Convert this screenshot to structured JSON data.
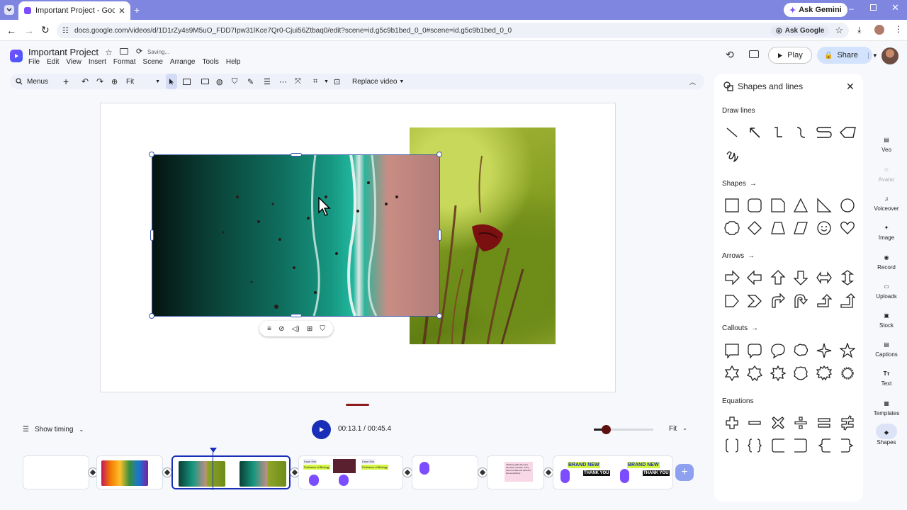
{
  "browser": {
    "tab_title": "Important Project - Google Vid",
    "ask_gemini": "Ask Gemini",
    "url": "docs.google.com/videos/d/1D1rZy4s9M5uO_FDD7Ipw31lKce7Qr0-Cjui56Ztbaq0/edit?scene=id.g5c9b1bed_0_0#scene=id.g5c9b1bed_0_0",
    "ask_google": "Ask Google"
  },
  "app": {
    "doc_title": "Important Project",
    "status": "Saving...",
    "menu": [
      "File",
      "Edit",
      "View",
      "Insert",
      "Format",
      "Scene",
      "Arrange",
      "Tools",
      "Help"
    ],
    "play_label": "Play",
    "share_label": "Share"
  },
  "toolbar": {
    "menus_label": "Menus",
    "zoom_value": "Fit",
    "replace_video": "Replace video"
  },
  "timeline": {
    "show_timing": "Show timing",
    "time": "00:13.1 / 00:45.4",
    "zoom_level": 0.2,
    "fit_label": "Fit",
    "scenes": [
      {
        "texts": []
      },
      {
        "texts": []
      },
      {
        "texts": []
      },
      {
        "texts": [
          "Kaori Kim",
          "Professor of Biology",
          "Kaori Kim",
          "Professor of Biology"
        ]
      },
      {
        "texts": []
      },
      {
        "texts": [
          "\"Working with this team has been a dream. They took our idea and turned it into something\""
        ]
      },
      {
        "texts": [
          "BRAND NEW",
          "THANK YOU",
          "BRAND NEW",
          "THANK YOU"
        ]
      }
    ]
  },
  "panel": {
    "title": "Shapes and lines",
    "sections": {
      "draw_lines": "Draw lines",
      "shapes": "Shapes",
      "arrows": "Arrows",
      "callouts": "Callouts",
      "equations": "Equations"
    }
  },
  "rail": [
    {
      "label": "Veo"
    },
    {
      "label": "Avatar"
    },
    {
      "label": "Voiceover"
    },
    {
      "label": "Image"
    },
    {
      "label": "Record"
    },
    {
      "label": "Uploads"
    },
    {
      "label": "Stock"
    },
    {
      "label": "Captions"
    },
    {
      "label": "Text"
    },
    {
      "label": "Templates"
    },
    {
      "label": "Shapes"
    }
  ],
  "colors": {
    "tabstrip": "#7f86e0",
    "accent": "#1a2fb8",
    "selection": "#3b58a6"
  }
}
